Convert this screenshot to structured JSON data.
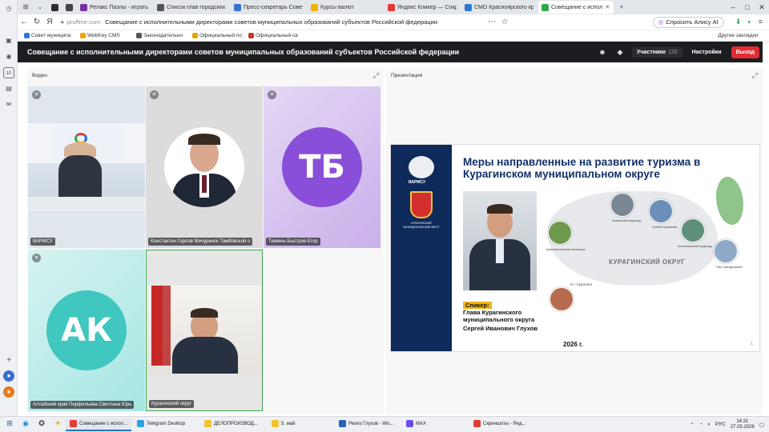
{
  "browser": {
    "tabs": [
      {
        "label": "",
        "color": "#2b2b2b"
      },
      {
        "label": "",
        "color": "#444444"
      },
      {
        "label": "Релакс Пазлы - играть он",
        "color": "#7a2ea6"
      },
      {
        "label": "Список глав городских о",
        "color": "#555555"
      },
      {
        "label": "Пресс-секретарь Совето",
        "color": "#3b6fd1"
      },
      {
        "label": "Курсы валют",
        "color": "#f0b400"
      },
      {
        "label": "Яндекс Кликер — Сокра",
        "color": "#e33b2e"
      },
      {
        "label": "СМО Красноярского края",
        "color": "#2a78d4"
      },
      {
        "label": "Совещание с испол",
        "color": "#2fa84f"
      }
    ],
    "active_tab": 8,
    "url_host": "pruffme.com",
    "page_title": "Совещание с исполнительными директорами советов муниципальных образований субъектов Российской федерации",
    "alice_label": "Спросить Алису AI",
    "bookmarks": [
      {
        "label": "Совет муниципа",
        "color": "#2a78d4"
      },
      {
        "label": "WebKey CMS",
        "color": "#f0a500"
      },
      {
        "label": "Законодательно",
        "color": "#555555"
      },
      {
        "label": "Официальный по",
        "color": "#e2a400"
      },
      {
        "label": "Официальный са",
        "color": "#c0392b"
      }
    ],
    "other_bookmarks": "Другие закладки"
  },
  "app": {
    "title": "Совещание с исполнительными директорами советов муниципальных образований субъектов Российской федерации",
    "participants_label": "Участники",
    "participants_count": "120",
    "settings_label": "Настройки",
    "exit_label": "Выход",
    "accent_exit": "#e22a33"
  },
  "video_panel": {
    "label": "Видео",
    "tiles": [
      {
        "name": "ВАРМСУ",
        "type": "video",
        "muted": true
      },
      {
        "name": "Константин Горлов Мичуринск Тамбовской о",
        "type": "photo",
        "muted": true
      },
      {
        "name": "Тюмень Быстров Егор",
        "type": "avatar",
        "initials": "ТБ",
        "color": "#8a4fd8",
        "muted": true
      },
      {
        "name": "Алтайский край Перфильева Светлана Юрь",
        "type": "avatar",
        "initials": "АК",
        "color": "#3fc7c0",
        "muted": true
      },
      {
        "name": "Курагинский округ",
        "type": "video",
        "muted": false,
        "speaking": true
      }
    ]
  },
  "presentation": {
    "label": "Презентация",
    "slide": {
      "title": "Меры направленные на развитие туризма в Курагинском муниципальном округе",
      "org": "ВАРМСУ",
      "district_caption": "КУРАГИНСКИЙ МУНИЦИПАЛЬНЫЙ ОКРУГ",
      "speaker_label": "Спикер:",
      "speaker_role": "Глава Курагинского муниципального округа",
      "speaker_name": "Сергей Иванович Глухов",
      "year": "2026 г.",
      "region_label": "КУРАГИНСКИЙ ОКРУГ",
      "village_label": "пгт. Курагино",
      "page_number": "1",
      "poi": [
        {
          "label": "Шалаболинская писаница"
        },
        {
          "label": "Казыкский водопад"
        },
        {
          "label": "Хребет Крыжина"
        },
        {
          "label": "Кинзелюкский водопад"
        },
        {
          "label": "Пик Грандиозный"
        }
      ]
    }
  },
  "taskbar": {
    "apps": [
      {
        "label": "Совещание с испол...",
        "color": "#e33b2e",
        "active": true
      },
      {
        "label": "Telegram Desktop",
        "color": "#2aa3de",
        "active": false
      },
      {
        "label": "ДЕЛОПРОИЗВОД...",
        "color": "#f2c230",
        "active": false
      },
      {
        "label": "5. май",
        "color": "#f2c230",
        "active": false
      },
      {
        "label": "Релиз Глухов - Wo...",
        "color": "#2b5fb4",
        "active": false
      },
      {
        "label": "MAX",
        "color": "#6b4ee6",
        "active": false
      },
      {
        "label": "Скриншоты - Янд...",
        "color": "#e33b2e",
        "active": false
      }
    ],
    "lang": "РУС",
    "time": "14:31",
    "date": "27.05.2026"
  }
}
